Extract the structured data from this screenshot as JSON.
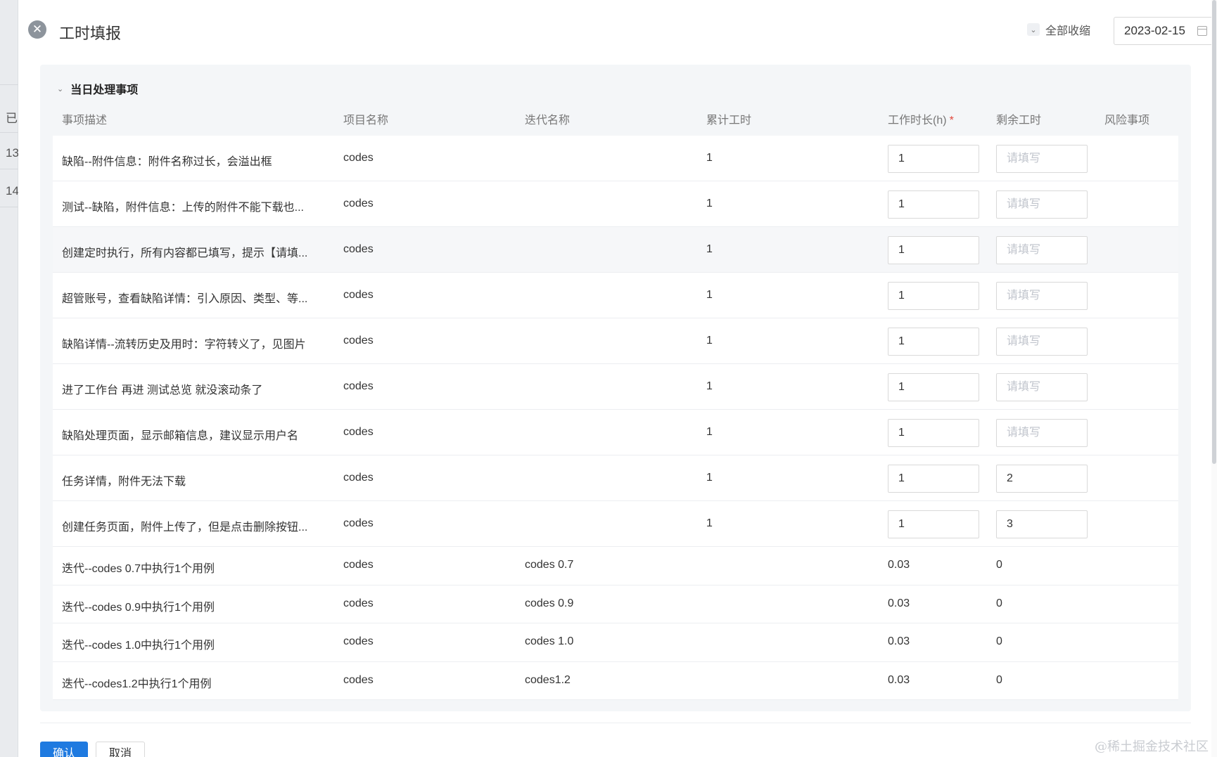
{
  "background": {
    "texts": [
      "已",
      "13",
      "14"
    ]
  },
  "header": {
    "title": "工时填报",
    "collapse_all_label": "全部收缩",
    "date": "2023-02-15"
  },
  "section": {
    "title": "当日处理事项",
    "columns": {
      "desc": "事项描述",
      "project": "项目名称",
      "iteration": "迭代名称",
      "cumulative": "累计工时",
      "work_hours": "工作时长(h)",
      "required_mark": "*",
      "remaining": "剩余工时",
      "risk": "风险事项"
    },
    "placeholder": "请填写",
    "rows": [
      {
        "desc": "缺陷--附件信息：附件名称过长，会溢出框",
        "project": "codes",
        "iteration": "",
        "cumulative": "1",
        "work_hours": "1",
        "remaining": ""
      },
      {
        "desc": "测试--缺陷，附件信息：上传的附件不能下载也...",
        "project": "codes",
        "iteration": "",
        "cumulative": "1",
        "work_hours": "1",
        "remaining": ""
      },
      {
        "desc": "创建定时执行，所有内容都已填写，提示【请填...",
        "project": "codes",
        "iteration": "",
        "cumulative": "1",
        "work_hours": "1",
        "remaining": ""
      },
      {
        "desc": "超管账号，查看缺陷详情：引入原因、类型、等...",
        "project": "codes",
        "iteration": "",
        "cumulative": "1",
        "work_hours": "1",
        "remaining": ""
      },
      {
        "desc": "缺陷详情--流转历史及用时：字符转义了，见图片",
        "project": "codes",
        "iteration": "",
        "cumulative": "1",
        "work_hours": "1",
        "remaining": ""
      },
      {
        "desc": "进了工作台 再进 测试总览 就没滚动条了",
        "project": "codes",
        "iteration": "",
        "cumulative": "1",
        "work_hours": "1",
        "remaining": ""
      },
      {
        "desc": "缺陷处理页面，显示邮箱信息，建议显示用户名",
        "project": "codes",
        "iteration": "",
        "cumulative": "1",
        "work_hours": "1",
        "remaining": ""
      },
      {
        "desc": "任务详情，附件无法下载",
        "project": "codes",
        "iteration": "",
        "cumulative": "1",
        "work_hours": "1",
        "remaining": "2"
      },
      {
        "desc": "创建任务页面，附件上传了，但是点击删除按钮...",
        "project": "codes",
        "iteration": "",
        "cumulative": "1",
        "work_hours": "1",
        "remaining": "3"
      }
    ],
    "static_rows": [
      {
        "desc": "迭代--codes 0.7中执行1个用例",
        "project": "codes",
        "iteration": "codes 0.7",
        "work_hours": "0.03",
        "remaining": "0"
      },
      {
        "desc": "迭代--codes 0.9中执行1个用例",
        "project": "codes",
        "iteration": "codes 0.9",
        "work_hours": "0.03",
        "remaining": "0"
      },
      {
        "desc": "迭代--codes 1.0中执行1个用例",
        "project": "codes",
        "iteration": "codes 1.0",
        "work_hours": "0.03",
        "remaining": "0"
      },
      {
        "desc": "迭代--codes1.2中执行1个用例",
        "project": "codes",
        "iteration": "codes1.2",
        "work_hours": "0.03",
        "remaining": "0"
      }
    ]
  },
  "footer": {
    "confirm_label": "确认",
    "cancel_label": "取消"
  },
  "watermark": "@稀土掘金技术社区"
}
